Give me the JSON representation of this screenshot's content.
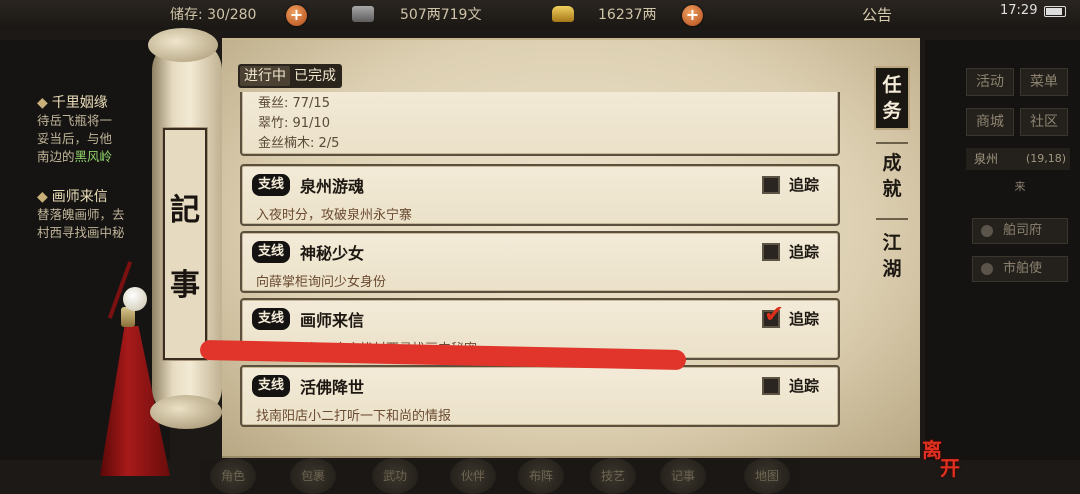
{
  "topbar": {
    "storage": "储存: 30/280",
    "silver": "507两719文",
    "gold": "16237两",
    "notice": "公告",
    "time": "17:29"
  },
  "left_panel": {
    "quest1_title": "千里姻缘",
    "quest1_lines": [
      "待岳飞瓶将一",
      "妥当后，与他",
      "南边的黑风岭"
    ],
    "quest1_highlight": "黑风岭",
    "quest2_title": "画师来信",
    "quest2_lines": [
      "替落魄画师，去",
      "村西寻找画中秘"
    ]
  },
  "right_panel": {
    "buttons": [
      "活动",
      "菜单",
      "商城",
      "社区"
    ],
    "location": "泉州",
    "coords": "(19,18)",
    "minimap_text": "来",
    "npcs": [
      "舶司府",
      "市舶使"
    ]
  },
  "bottom_menu": [
    "角色",
    "包裹",
    "武功",
    "伙伴",
    "布阵",
    "技艺",
    "记事",
    "地图"
  ],
  "scroll": {
    "title_chars": [
      "記",
      "事"
    ]
  },
  "journal": {
    "tabs": {
      "ongoing": "进行中",
      "completed": "已完成"
    },
    "partial_card": {
      "materials": [
        "蚕丝: 77/15",
        "翠竹: 91/10",
        "金丝楠木: 2/5"
      ]
    },
    "quests": [
      {
        "type": "支线",
        "name": "泉州游魂",
        "desc": "入夜时分，攻破泉州永宁寨",
        "track_label": "追踪",
        "tracked": false
      },
      {
        "type": "支线",
        "name": "神秘少女",
        "desc": "向薛掌柜询问少女身份",
        "track_label": "追踪",
        "tracked": false
      },
      {
        "type": "支线",
        "name": "画师来信",
        "desc": "替落魄画师，去忘忧村西寻找画中秘密。",
        "track_label": "追踪",
        "tracked": true
      },
      {
        "type": "支线",
        "name": "活佛降世",
        "desc": "找南阳店小二打听一下和尚的情报",
        "track_label": "追踪",
        "tracked": false
      }
    ],
    "categories": [
      {
        "label": "任务",
        "active": true
      },
      {
        "label": "成就",
        "active": false
      },
      {
        "label": "江湖",
        "active": false
      }
    ]
  },
  "leave_button": {
    "chars": [
      "离",
      "开"
    ]
  },
  "colors": {
    "accent_red": "#e1352c",
    "parchment": "#efe5cf",
    "badge_bg": "#151311",
    "highlight_green": "#8fd36a"
  }
}
